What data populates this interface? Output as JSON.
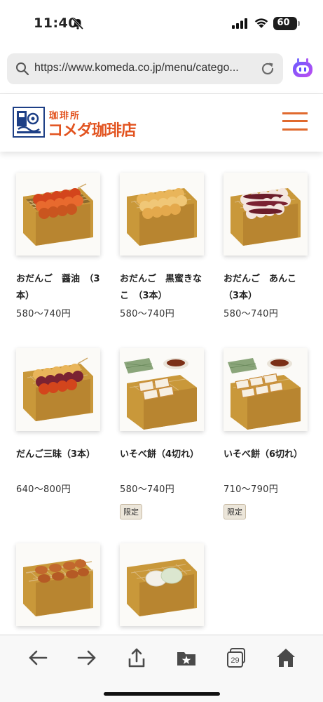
{
  "status_bar": {
    "time": "11:40",
    "battery": "60"
  },
  "browser": {
    "url": "https://www.komeda.co.jp/menu/catego..."
  },
  "site": {
    "logo_sub": "珈琲所",
    "logo_main": "コメダ珈琲店"
  },
  "products": [
    {
      "name": "おだんご　醤油　（3本）",
      "price": "580〜740円",
      "badge": "",
      "image": "dango-soy"
    },
    {
      "name": "おだんご　黒蜜きなこ　（3本）",
      "price": "580〜740円",
      "badge": "",
      "image": "dango-kinako"
    },
    {
      "name": "おだんご　あんこ　（3本）",
      "price": "580〜740円",
      "badge": "",
      "image": "dango-anko"
    },
    {
      "name": "だんご三昧（3本）",
      "price": "640〜800円",
      "badge": "",
      "image": "dango-mix"
    },
    {
      "name": "いそべ餅（4切れ）",
      "price": "580〜740円",
      "badge": "限定",
      "image": "isobe-4"
    },
    {
      "name": "いそべ餅（6切れ）",
      "price": "710〜790円",
      "badge": "限定",
      "image": "isobe-6"
    },
    {
      "name": "",
      "price": "",
      "badge": "",
      "image": "skewer-mochi"
    },
    {
      "name": "",
      "price": "",
      "badge": "",
      "image": "daifuku"
    }
  ],
  "toolbar": {
    "tabs_count": "29"
  },
  "colors": {
    "brand_orange": "#e2531f",
    "brand_navy": "#1d3f86",
    "grill_gold": "#c9983a"
  }
}
